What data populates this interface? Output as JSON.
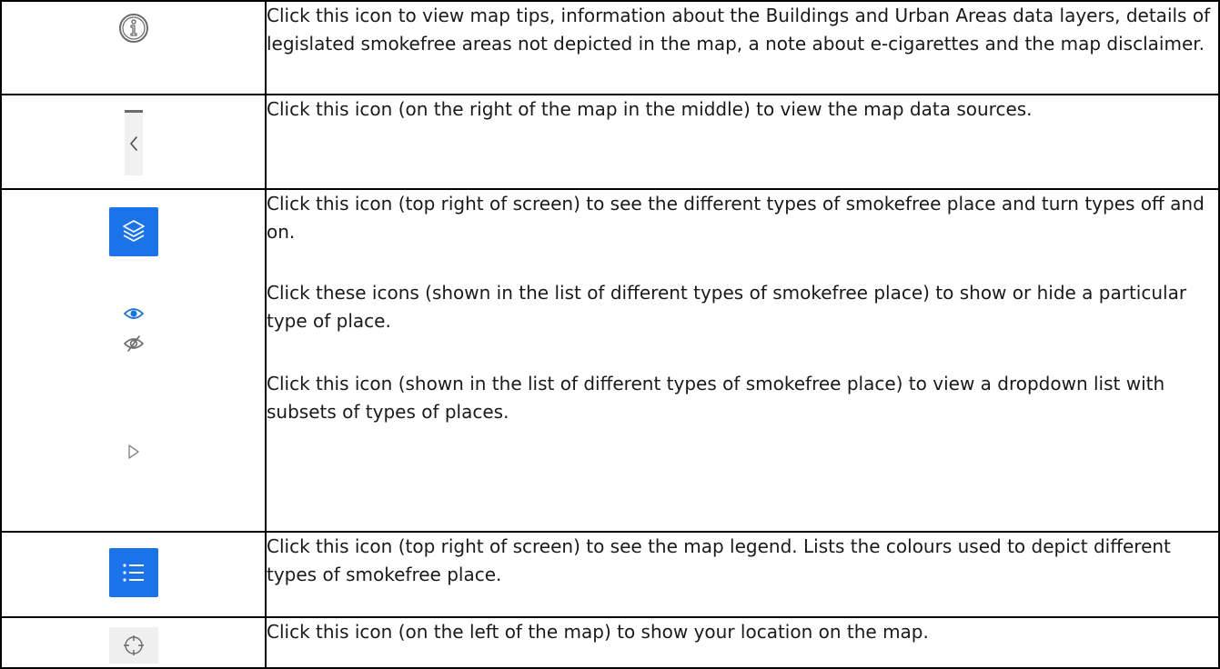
{
  "rows": [
    {
      "icon": "info-icon",
      "text": "Click this icon to view map tips, information about the Buildings and Urban Areas data layers, details of legislated smokefree areas not depicted in the map, a note about e-cigarettes and the map disclaimer."
    },
    {
      "icon": "chevron-left-panel-icon",
      "text": "Click this icon (on the right of the map in the middle) to view the map data sources."
    },
    {
      "icons": [
        "layers-icon",
        "eye-icon",
        "eye-off-icon",
        "triangle-right-icon"
      ],
      "texts": [
        "Click this icon (top right of screen) to see the different types of smokefree place and turn types off and on.",
        "Click these icons (shown in the list of different types of smokefree place) to show or hide a particular type of place.",
        "Click this icon (shown in the list of different types of smokefree place) to view a dropdown list with subsets of types of places."
      ]
    },
    {
      "icon": "legend-list-icon",
      "text": "Click this icon (top right of screen) to see the map legend. Lists the colours used to depict different types of smokefree place."
    },
    {
      "icon": "locate-crosshair-icon",
      "text": "Click this icon (on the left of the map) to show your location on the map."
    }
  ],
  "colors": {
    "accent_blue": "#1a73e8",
    "border": "#000000",
    "icon_gray": "#6b6b6b"
  }
}
